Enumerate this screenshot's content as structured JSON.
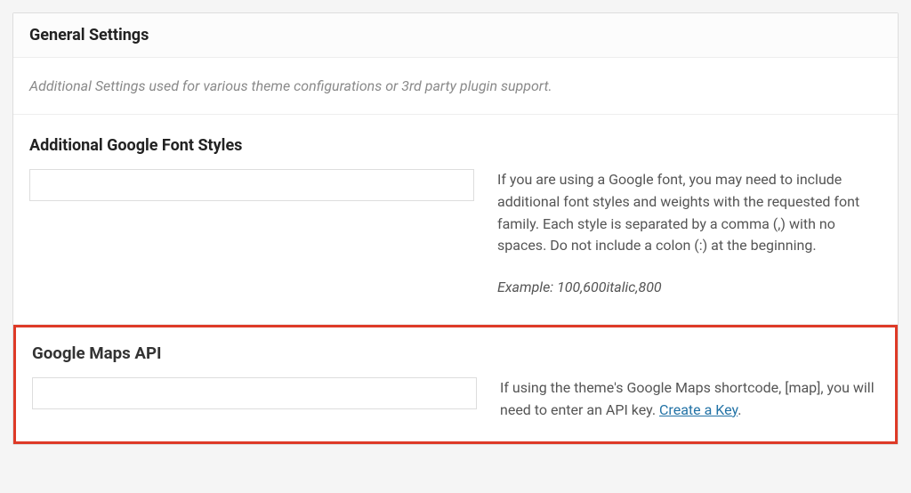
{
  "panel": {
    "title": "General Settings",
    "description": "Additional Settings used for various theme configurations or 3rd party plugin support."
  },
  "fonts": {
    "heading": "Additional Google Font Styles",
    "value": "",
    "help": "If you are using a Google font, you may need to include additional font styles and weights with the requested font family. Each style is separated by a comma (,) with no spaces. Do not include a colon (:) at the beginning.",
    "example_label": "Example:",
    "example_value": "100,600italic,800"
  },
  "maps": {
    "heading": "Google Maps API",
    "value": "",
    "help_prefix": "If using the theme's Google Maps shortcode, [map], you will need to enter an API key. ",
    "link_text": "Create a Key",
    "help_suffix": "."
  }
}
